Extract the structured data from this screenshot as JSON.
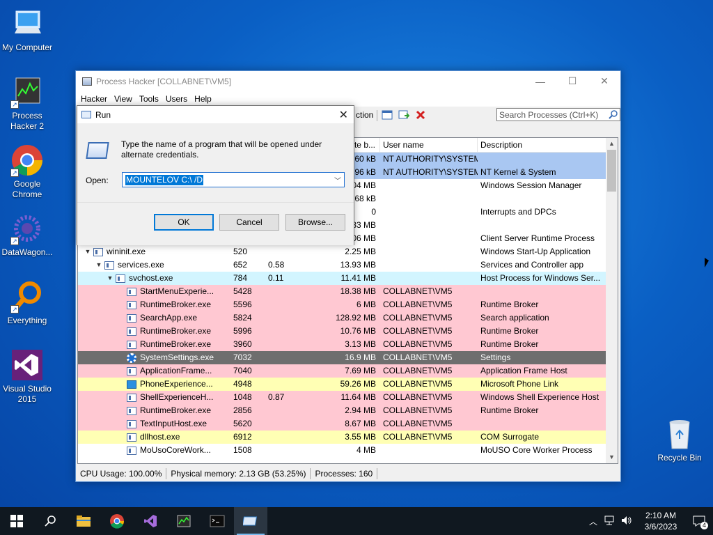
{
  "desktop": {
    "icons": [
      {
        "label": "My Computer"
      },
      {
        "label": "Process Hacker 2"
      },
      {
        "label": "Google Chrome"
      },
      {
        "label": "DataWagon..."
      },
      {
        "label": "Everything"
      },
      {
        "label": "Visual Studio 2015"
      }
    ],
    "recycle_bin": "Recycle Bin"
  },
  "ph": {
    "title": "Process Hacker [COLLABNET\\VM5]",
    "menu": [
      "Hacker",
      "View",
      "Tools",
      "Users",
      "Help"
    ],
    "toolbar_fragment": "ction",
    "search_placeholder": "Search Processes (Ctrl+K)",
    "columns": {
      "priv": "ate b...",
      "user": "User name",
      "desc": "Description"
    },
    "rows": [
      {
        "name": "",
        "pid": "",
        "cpu": "",
        "priv": "60 kB",
        "user": "NT AUTHORITY\\SYSTEM",
        "desc": "",
        "bg": "blue"
      },
      {
        "name": "",
        "pid": "",
        "cpu": "",
        "priv": "196 kB",
        "user": "NT AUTHORITY\\SYSTEM",
        "desc": "NT Kernel & System",
        "bg": "blue"
      },
      {
        "name": "",
        "pid": "",
        "cpu": "",
        "priv": "04 MB",
        "user": "",
        "desc": "Windows Session Manager",
        "bg": "white"
      },
      {
        "name": "",
        "pid": "",
        "cpu": "",
        "priv": "168 kB",
        "user": "",
        "desc": "",
        "bg": "white"
      },
      {
        "name": "",
        "pid": "",
        "cpu": "",
        "priv": "0",
        "user": "",
        "desc": "Interrupts and DPCs",
        "bg": "white"
      },
      {
        "name": "",
        "pid": "",
        "cpu": "",
        "priv": "83 MB",
        "user": "",
        "desc": "",
        "bg": "white"
      },
      {
        "name": "",
        "pid": "",
        "cpu": "",
        "priv": "06 MB",
        "user": "",
        "desc": "Client Server Runtime Process",
        "bg": "white"
      },
      {
        "name": "wininit.exe",
        "pid": "520",
        "cpu": "",
        "priv": "2.25 MB",
        "user": "",
        "desc": "Windows Start-Up Application",
        "bg": "white"
      },
      {
        "name": "services.exe",
        "pid": "652",
        "cpu": "0.58",
        "priv": "13.93 MB",
        "user": "",
        "desc": "Services and Controller app",
        "bg": "white"
      },
      {
        "name": "svchost.exe",
        "pid": "784",
        "cpu": "0.11",
        "priv": "11.41 MB",
        "user": "",
        "desc": "Host Process for Windows Ser...",
        "bg": "cyan"
      },
      {
        "name": "StartMenuExperie...",
        "pid": "5428",
        "cpu": "",
        "priv": "18.38 MB",
        "user": "COLLABNET\\VM5",
        "desc": "",
        "bg": "pink"
      },
      {
        "name": "RuntimeBroker.exe",
        "pid": "5596",
        "cpu": "",
        "priv": "6 MB",
        "user": "COLLABNET\\VM5",
        "desc": "Runtime Broker",
        "bg": "pink"
      },
      {
        "name": "SearchApp.exe",
        "pid": "5824",
        "cpu": "",
        "priv": "128.92 MB",
        "user": "COLLABNET\\VM5",
        "desc": "Search application",
        "bg": "pink"
      },
      {
        "name": "RuntimeBroker.exe",
        "pid": "5996",
        "cpu": "",
        "priv": "10.76 MB",
        "user": "COLLABNET\\VM5",
        "desc": "Runtime Broker",
        "bg": "pink"
      },
      {
        "name": "RuntimeBroker.exe",
        "pid": "3960",
        "cpu": "",
        "priv": "3.13 MB",
        "user": "COLLABNET\\VM5",
        "desc": "Runtime Broker",
        "bg": "pink"
      },
      {
        "name": "SystemSettings.exe",
        "pid": "7032",
        "cpu": "",
        "priv": "16.9 MB",
        "user": "COLLABNET\\VM5",
        "desc": "Settings",
        "bg": "sel"
      },
      {
        "name": "ApplicationFrame...",
        "pid": "7040",
        "cpu": "",
        "priv": "7.69 MB",
        "user": "COLLABNET\\VM5",
        "desc": "Application Frame Host",
        "bg": "pink"
      },
      {
        "name": "PhoneExperience...",
        "pid": "4948",
        "cpu": "",
        "priv": "59.26 MB",
        "user": "COLLABNET\\VM5",
        "desc": "Microsoft Phone Link",
        "bg": "yellow"
      },
      {
        "name": "ShellExperienceH...",
        "pid": "1048",
        "cpu": "0.87",
        "priv": "11.64 MB",
        "user": "COLLABNET\\VM5",
        "desc": "Windows Shell Experience Host",
        "bg": "pink"
      },
      {
        "name": "RuntimeBroker.exe",
        "pid": "2856",
        "cpu": "",
        "priv": "2.94 MB",
        "user": "COLLABNET\\VM5",
        "desc": "Runtime Broker",
        "bg": "pink"
      },
      {
        "name": "TextInputHost.exe",
        "pid": "5620",
        "cpu": "",
        "priv": "8.67 MB",
        "user": "COLLABNET\\VM5",
        "desc": "",
        "bg": "pink"
      },
      {
        "name": "dllhost.exe",
        "pid": "6912",
        "cpu": "",
        "priv": "3.55 MB",
        "user": "COLLABNET\\VM5",
        "desc": "COM Surrogate",
        "bg": "yellow"
      },
      {
        "name": "MoUsoCoreWork...",
        "pid": "1508",
        "cpu": "",
        "priv": "4 MB",
        "user": "",
        "desc": "MoUSO Core Worker Process",
        "bg": "white"
      }
    ],
    "status": {
      "cpu": "CPU Usage: 100.00%",
      "mem": "Physical memory: 2.13 GB (53.25%)",
      "procs": "Processes: 160"
    }
  },
  "run": {
    "title": "Run",
    "description": "Type the name of a program that will be opened under alternate credentials.",
    "open_label": "Open:",
    "open_value": "MOUNTELOV C:\\ /D",
    "ok": "OK",
    "cancel": "Cancel",
    "browse": "Browse..."
  },
  "taskbar": {
    "time": "2:10 AM",
    "date": "3/6/2023",
    "notif_count": "4"
  }
}
